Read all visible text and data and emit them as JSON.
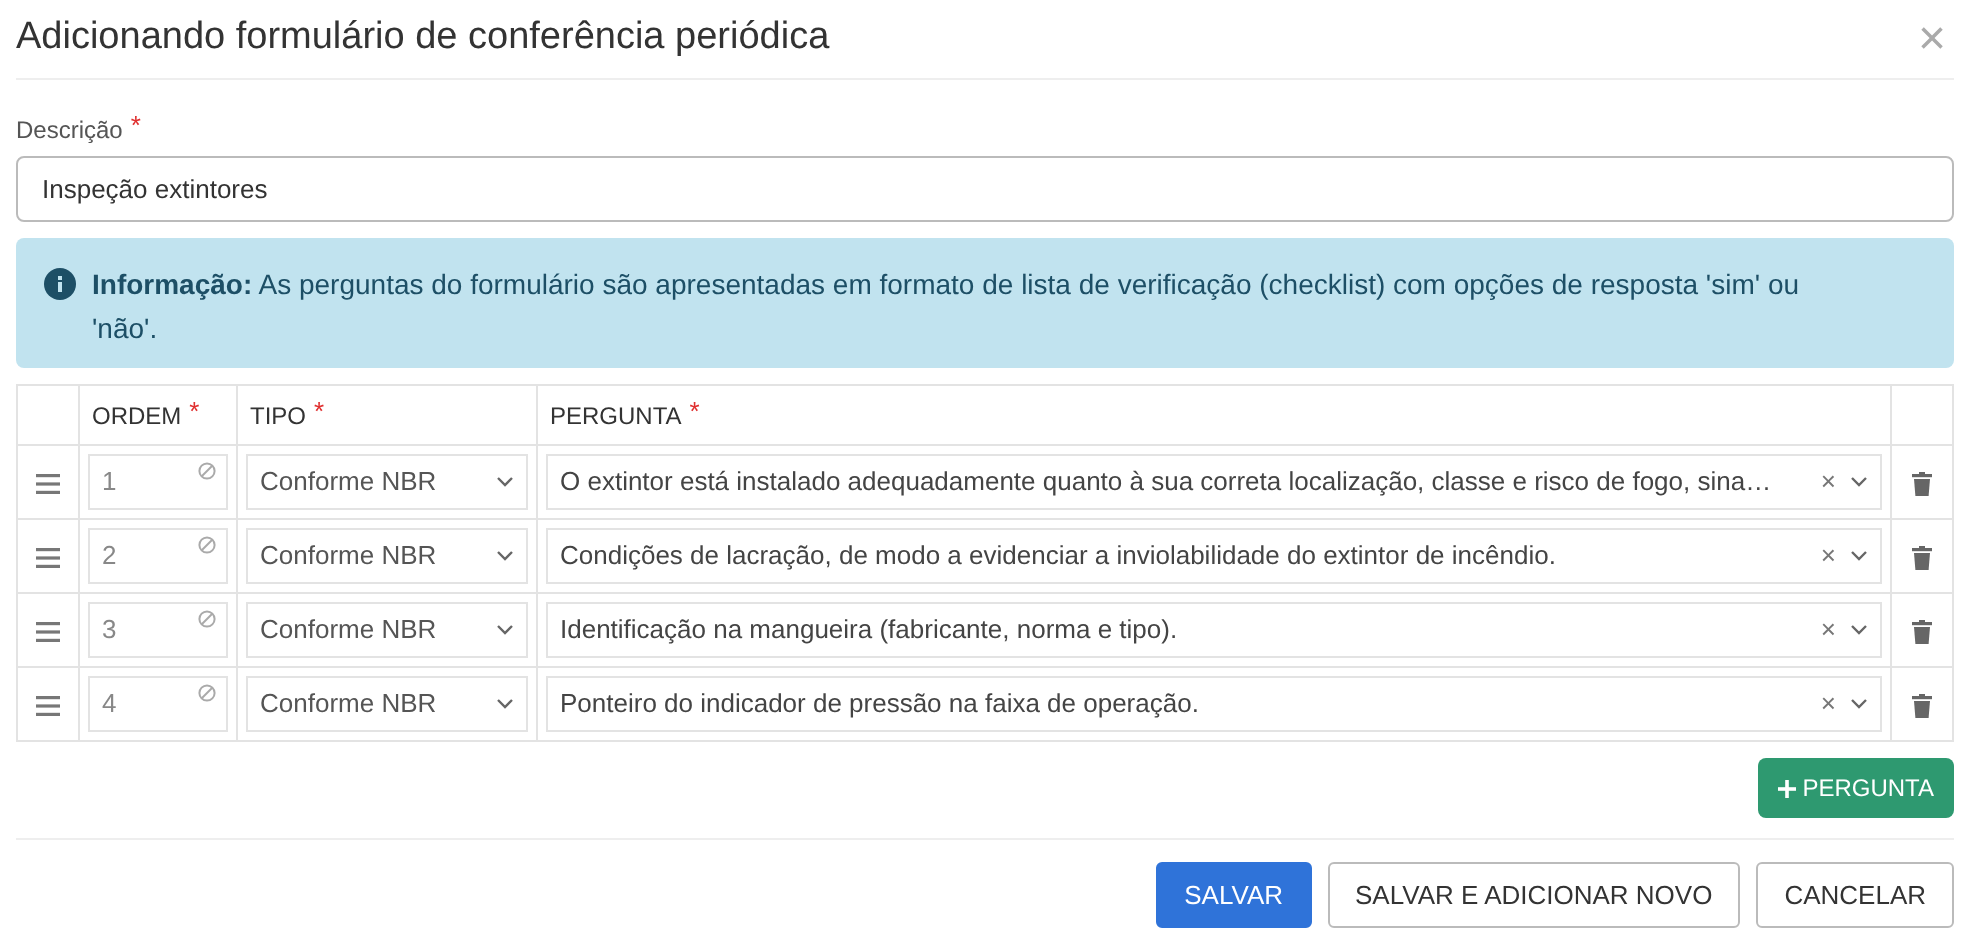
{
  "modal": {
    "title": "Adicionando formulário de conferência periódica",
    "close": "×"
  },
  "description": {
    "label": "Descrição",
    "required_mark": "*",
    "value": "Inspeção extintores"
  },
  "alert": {
    "text": "**Informação:** As perguntas do formulário são apresentadas em formato de lista de verificação (checklist) com opções de resposta 'sim' ou 'não'."
  },
  "table": {
    "columns": [
      {
        "label": "ORDEM",
        "required_mark": "*"
      },
      {
        "label": "TIPO",
        "required_mark": "*"
      },
      {
        "label": "PERGUNTA",
        "required_mark": "*"
      }
    ],
    "rows": [
      {
        "order": "1",
        "order_disabled": true,
        "type": "Conforme NBR",
        "question": "O extintor está instalado adequadamente quanto à sua correta localização, classe e risco de fogo, sina…",
        "clear": "×"
      },
      {
        "order": "2",
        "order_disabled": true,
        "type": "Conforme NBR",
        "question": "Condições de lacração, de modo a evidenciar a inviolabilidade do extintor de incêndio.",
        "clear": "×"
      },
      {
        "order": "3",
        "order_disabled": true,
        "type": "Conforme NBR",
        "question": "Identificação na mangueira (fabricante, norma e tipo).",
        "clear": "×"
      },
      {
        "order": "4",
        "order_disabled": true,
        "type": "Conforme NBR",
        "question": "Ponteiro do indicador de pressão na faixa de operação.",
        "clear": "×"
      }
    ]
  },
  "add_button": {
    "label": "PERGUNTA"
  },
  "buttons": [
    {
      "label": "SALVAR",
      "kind": "primary"
    },
    {
      "label": "SALVAR E ADICIONAR NOVO",
      "kind": "outline"
    },
    {
      "label": "CANCELAR",
      "kind": "outline"
    }
  ]
}
